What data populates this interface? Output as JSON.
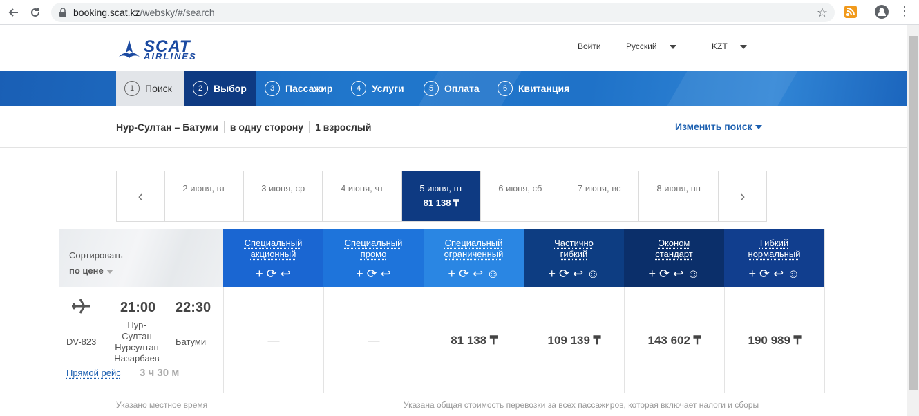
{
  "browser": {
    "url_host": "booking.scat.kz",
    "url_path": "/websky/#/search",
    "icons": [
      "back-arrow-icon",
      "reload-icon",
      "lock-icon",
      "star-icon",
      "rss-icon",
      "profile-icon",
      "menu-icon"
    ]
  },
  "header": {
    "logo_top": "SCAT",
    "logo_bottom": "AIRLINES",
    "login": "Войти",
    "language": "Русский",
    "currency": "KZT"
  },
  "steps": [
    {
      "num": "1",
      "label": "Поиск",
      "state": "done"
    },
    {
      "num": "2",
      "label": "Выбор",
      "state": "active"
    },
    {
      "num": "3",
      "label": "Пассажир",
      "state": "todo"
    },
    {
      "num": "4",
      "label": "Услуги",
      "state": "todo"
    },
    {
      "num": "5",
      "label": "Оплата",
      "state": "todo"
    },
    {
      "num": "6",
      "label": "Квитанция",
      "state": "todo"
    }
  ],
  "summary": {
    "route": "Нур-Султан – Батуми",
    "trip_type": "в одну сторону",
    "passengers": "1 взрослый",
    "change_search": "Изменить поиск"
  },
  "dates": {
    "prev": "‹",
    "next": "›",
    "items": [
      {
        "label": "2 июня, вт",
        "price": ""
      },
      {
        "label": "3 июня, ср",
        "price": ""
      },
      {
        "label": "4 июня, чт",
        "price": ""
      },
      {
        "label": "5 июня, пт",
        "price": "81 138 ₸",
        "selected": true
      },
      {
        "label": "6 июня, сб",
        "price": ""
      },
      {
        "label": "7 июня, вс",
        "price": ""
      },
      {
        "label": "8 июня, пн",
        "price": ""
      }
    ]
  },
  "sort": {
    "label": "Сортировать",
    "value": "по цене"
  },
  "fares": [
    {
      "name_l1": "Специальный",
      "name_l2": "акционный",
      "color": "#1a66d2",
      "icons": "+ ⟳ ↩",
      "price": "—"
    },
    {
      "name_l1": "Специальный",
      "name_l2": "промо",
      "color": "#1e74db",
      "icons": "+ ⟳ ↩",
      "price": "—"
    },
    {
      "name_l1": "Специальный",
      "name_l2": "ограниченный",
      "color": "#2a86e3",
      "icons": "+ ⟳ ↩ ☺",
      "price": "81 138 ₸"
    },
    {
      "name_l1": "Частично",
      "name_l2": "гибкий",
      "color": "#0d3d82",
      "icons": "+ ⟳ ↩ ☺",
      "price": "109 139 ₸"
    },
    {
      "name_l1": "Эконом",
      "name_l2": "стандарт",
      "color": "#0b2f6a",
      "icons": "+ ⟳ ↩ ☺",
      "price": "143 602 ₸"
    },
    {
      "name_l1": "Гибкий",
      "name_l2": "нормальный",
      "color": "#113e8e",
      "icons": "+ ⟳ ↩ ☺",
      "price": "190 989 ₸"
    }
  ],
  "flight": {
    "number": "DV-823",
    "dep_time": "21:00",
    "arr_time": "22:30",
    "dep_city_l1": "Нур-",
    "dep_city_l2": "Султан",
    "dep_city_l3": "Нурсултан",
    "dep_city_l4": "Назарбаев",
    "arr_city": "Батуми",
    "direct": "Прямой рейс",
    "duration": "3 ч 30 м"
  },
  "footer": {
    "local_time": "Указано местное время",
    "total_note": "Указана общая стоимость перевозки за всех пассажиров, которая включает налоги и сборы"
  }
}
